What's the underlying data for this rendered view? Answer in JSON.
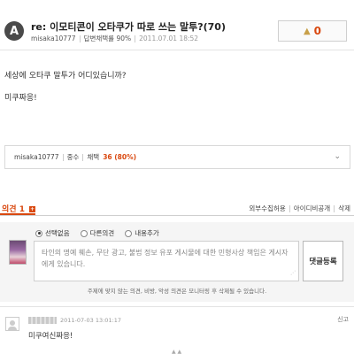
{
  "answer": {
    "avatar_letter": "A",
    "title": "re: 이모티콘이 오타쿠가 따로 쓰는 말투?(70)",
    "author": "misaka10777",
    "adoption_rate": "답변채택률 90%",
    "date": "2011.07.01 18:52",
    "like_count": "0"
  },
  "body": {
    "lines": [
      "세상에 오타쿠 말투가 어디있습니까?",
      "미쿠짜응!"
    ]
  },
  "profile": {
    "name": "misaka10777",
    "rank": "중수",
    "rate_label": "채택",
    "rate_value": "36 (80%)",
    "expand": "⌄"
  },
  "comments": {
    "label": "의견",
    "count": "1",
    "plus": "+",
    "actions": [
      "외부수집허용",
      "아이디비공개",
      "삭제"
    ],
    "options": [
      "선택없음",
      "다른의견",
      "내용추가"
    ],
    "placeholder": "타인의 명예 훼손, 무단 광고, 불법 정보 유포 게시물에 대한 민형사상 책임은 게시자에게 있습니다.",
    "submit": "댓글등록",
    "notice": "주제에 맞지 않는 의견, 비방, 악성 의견은 모니터링 후 삭제될 수 있습니다."
  },
  "comment_item": {
    "date": "2011-07-03 13:01:17",
    "report": "신고",
    "text": "미쿠여신짜응!"
  }
}
